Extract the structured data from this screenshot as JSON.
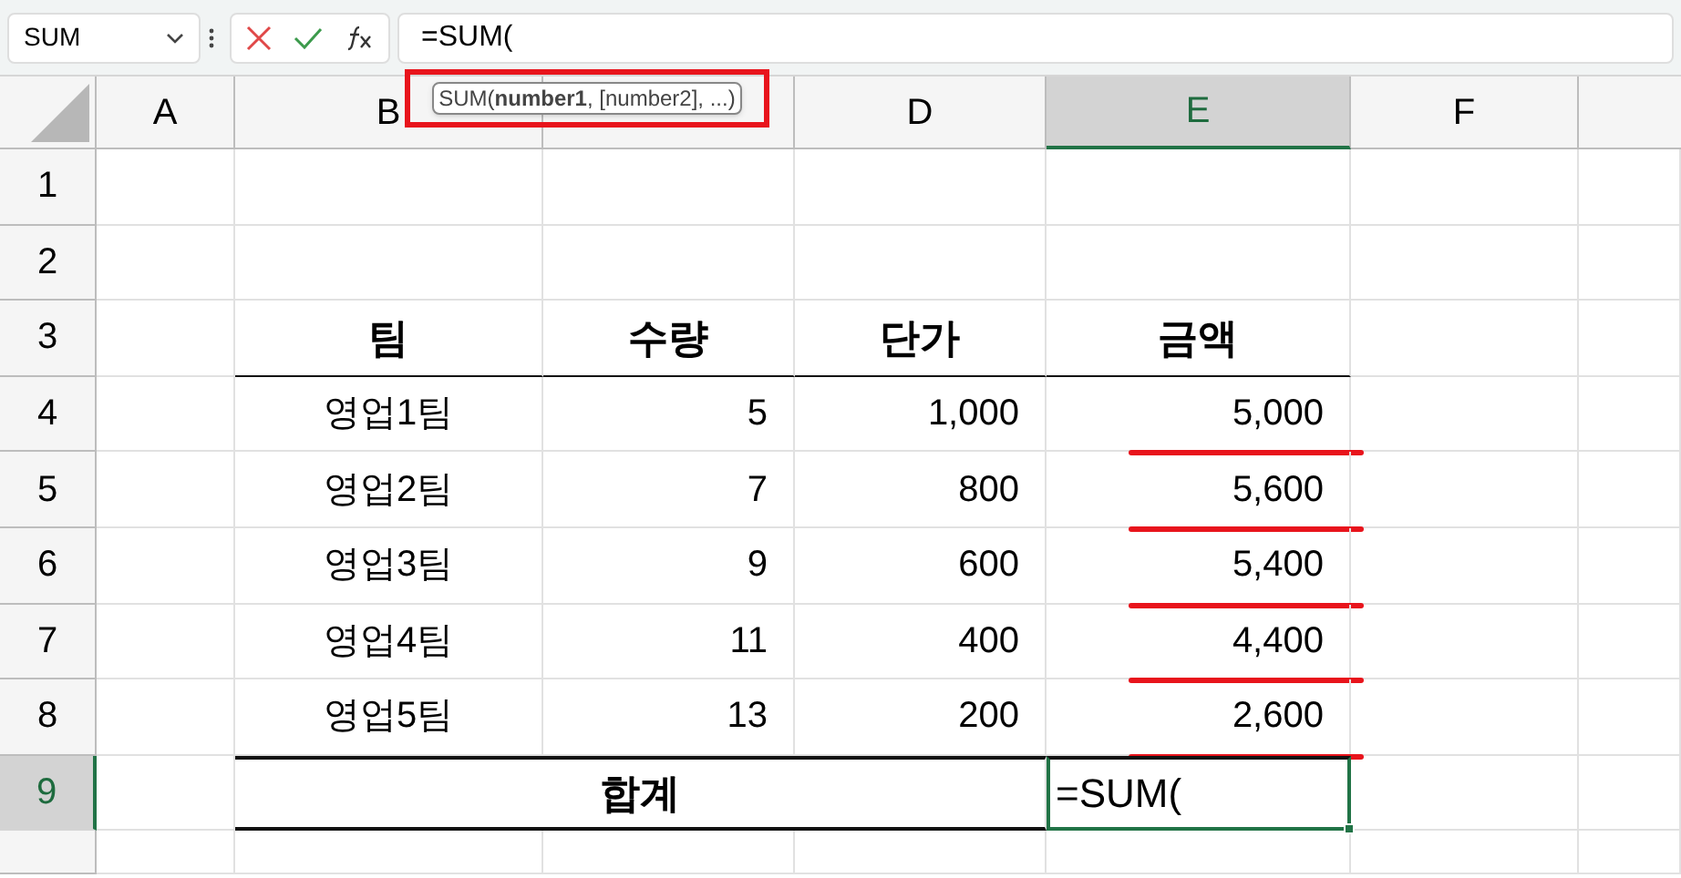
{
  "name_box": {
    "value": "SUM"
  },
  "formula_bar": {
    "value": "=SUM("
  },
  "tooltip": {
    "text": "SUM(**number1**, [number2], ...)",
    "highlighted": true
  },
  "columns": [
    {
      "label": "A",
      "selected": false
    },
    {
      "label": "B",
      "selected": false
    },
    {
      "selected": false
    },
    {
      "label": "D",
      "selected": false
    },
    {
      "label": "E",
      "selected": true
    },
    {
      "label": "F",
      "selected": false
    }
  ],
  "rows": [
    {
      "label": "1",
      "selected": false
    },
    {
      "label": "2",
      "selected": false
    },
    {
      "label": "3",
      "selected": false
    },
    {
      "label": "4",
      "selected": false
    },
    {
      "label": "5",
      "selected": false
    },
    {
      "label": "6",
      "selected": false
    },
    {
      "label": "7",
      "selected": false
    },
    {
      "label": "8",
      "selected": false
    },
    {
      "label": "9",
      "selected": true
    },
    {
      "selected": false
    }
  ],
  "table": {
    "headers": [
      "팀",
      "수량",
      "단가",
      "금액"
    ],
    "rows": [
      {
        "team": "영업1팀",
        "qty": "5",
        "price": "1,000",
        "amount": "5,000",
        "underlined": true
      },
      {
        "team": "영업2팀",
        "qty": "7",
        "price": "800",
        "amount": "5,600",
        "underlined": true
      },
      {
        "team": "영업3팀",
        "qty": "9",
        "price": "600",
        "amount": "5,400",
        "underlined": true
      },
      {
        "team": "영업4팀",
        "qty": "11",
        "price": "400",
        "amount": "4,400",
        "underlined": true
      },
      {
        "team": "영업5팀",
        "qty": "13",
        "price": "200",
        "amount": "2,600",
        "underlined": true
      }
    ],
    "total": {
      "label": "합계",
      "value": "=SUM(",
      "editing": true
    }
  }
}
